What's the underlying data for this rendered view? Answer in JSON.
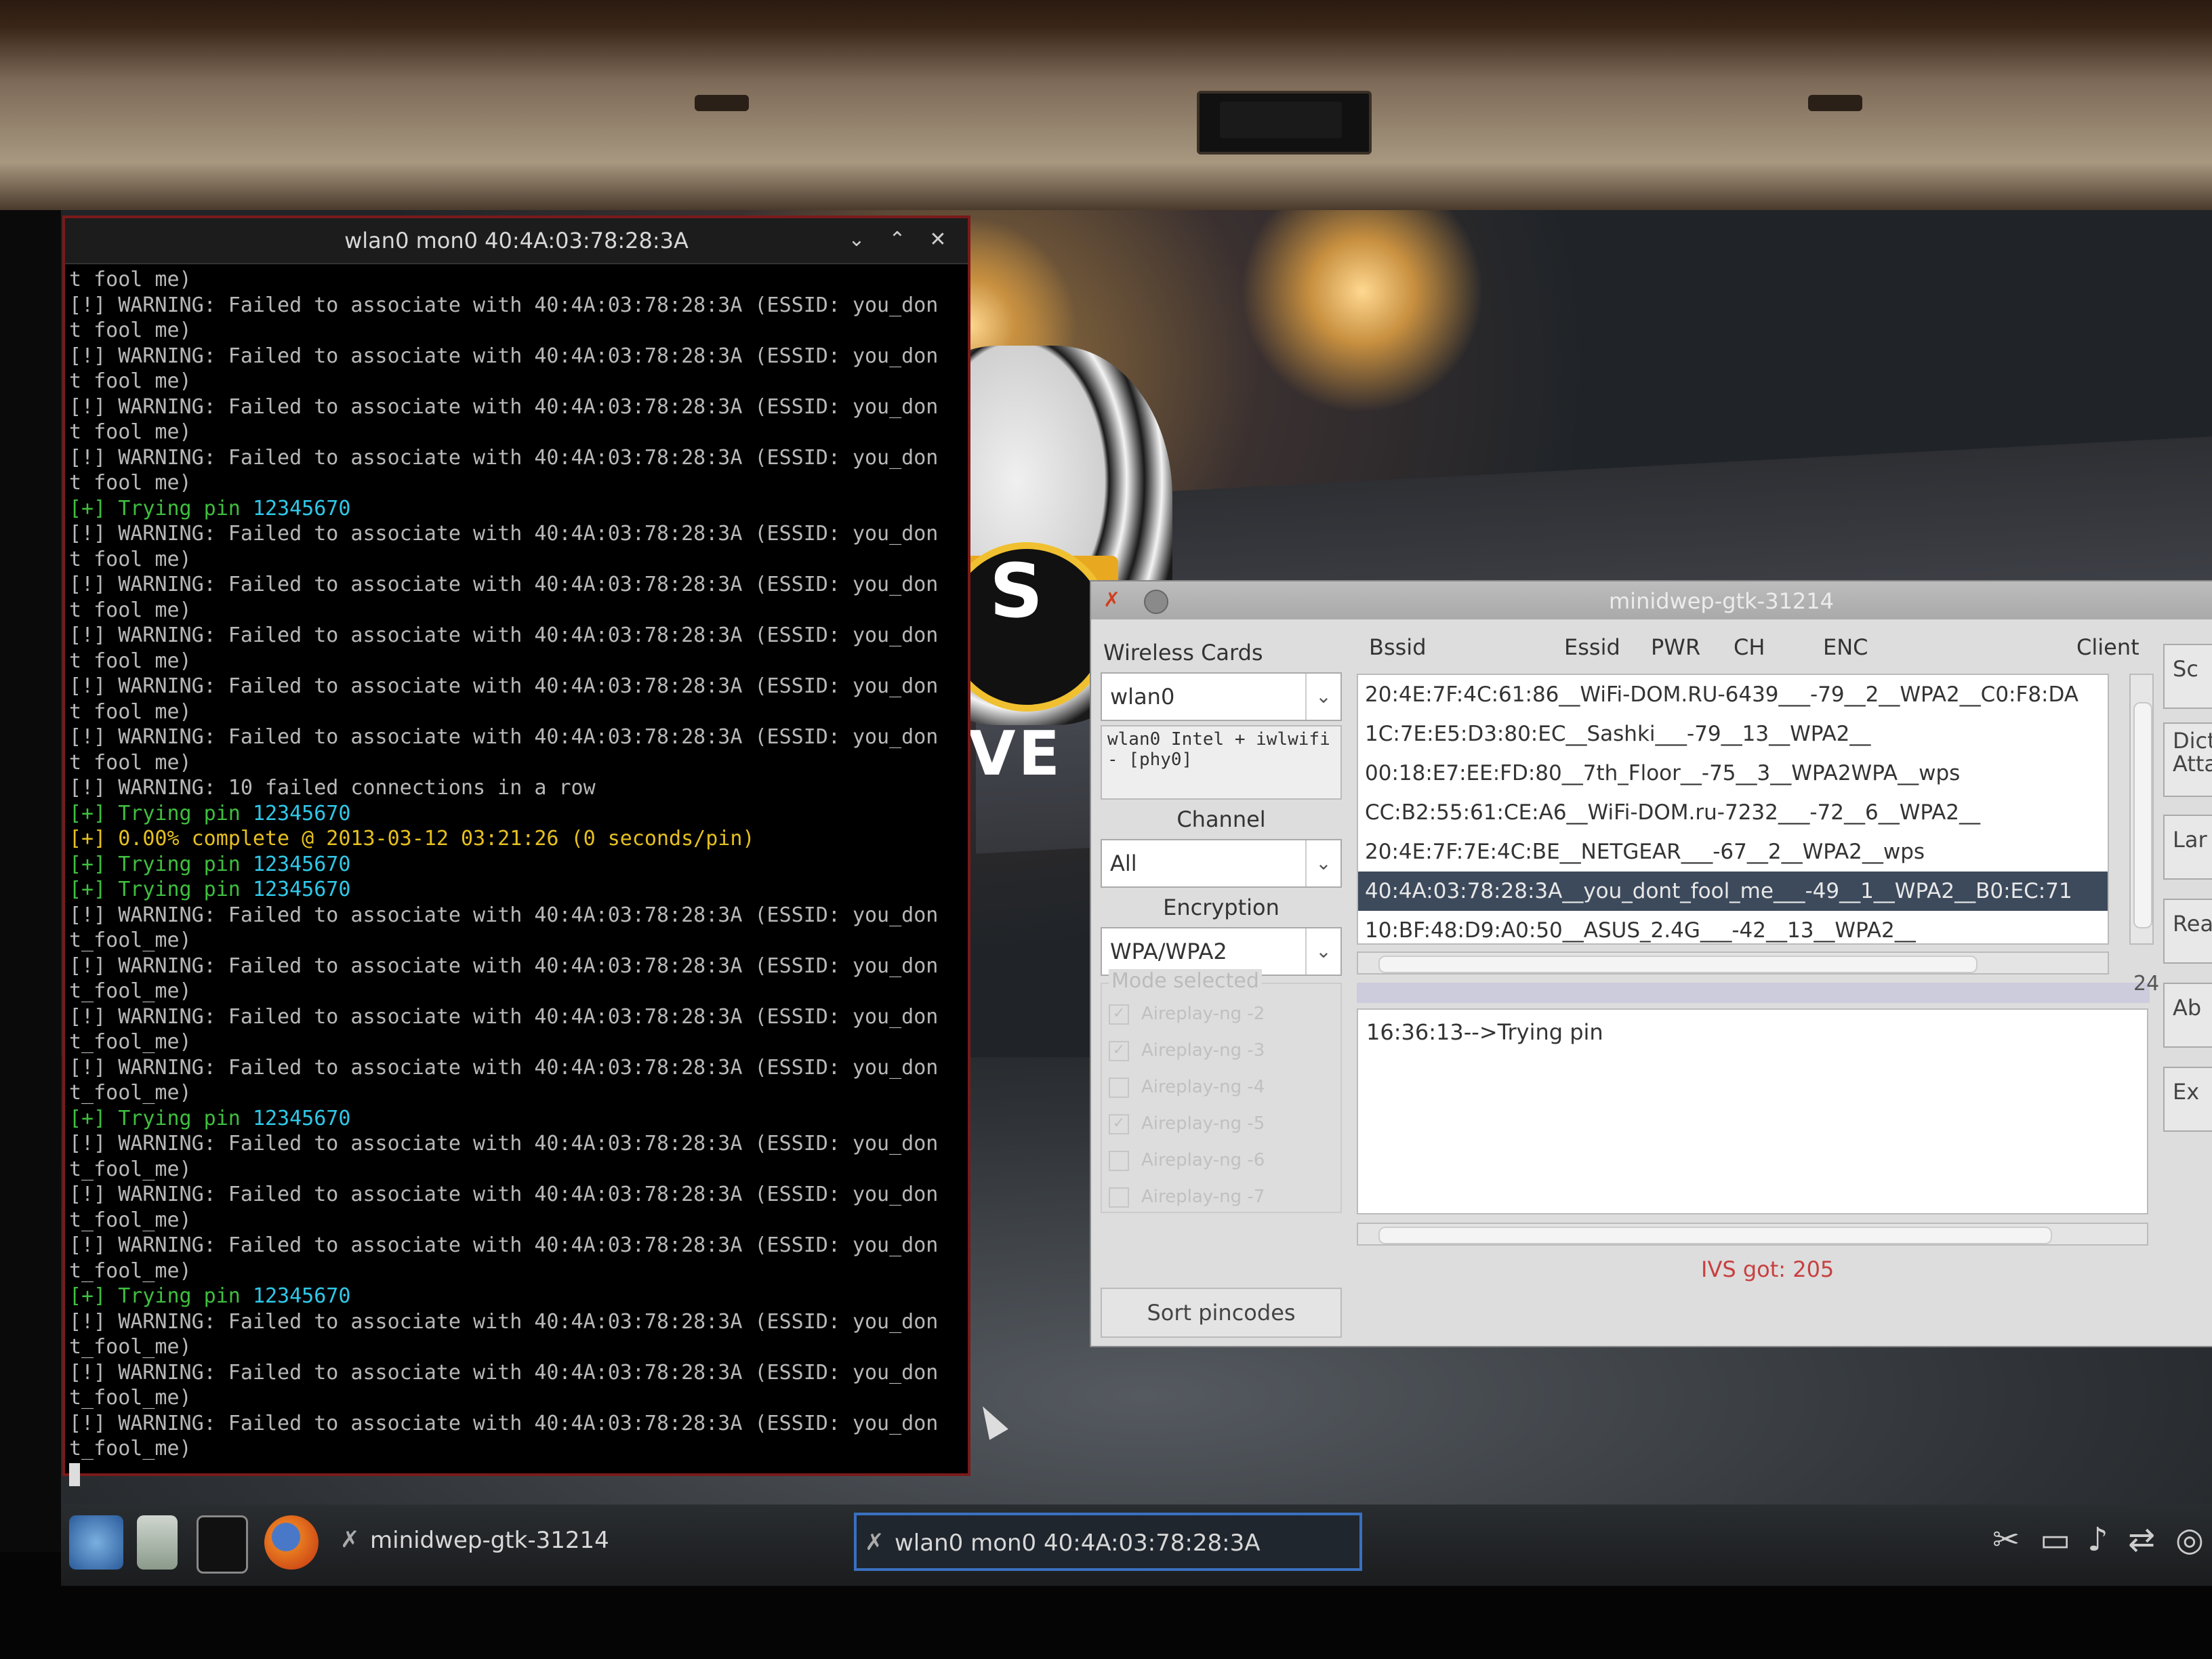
{
  "terminal": {
    "title": "wlan0 mon0 40:4A:03:78:28:3A",
    "lines": [
      {
        "text": "t fool me)",
        "class": ""
      },
      {
        "text": "[!] WARNING: Failed to associate with 40:4A:03:78:28:3A (ESSID: you_don",
        "class": ""
      },
      {
        "text": "t fool me)",
        "class": ""
      },
      {
        "text": "[!] WARNING: Failed to associate with 40:4A:03:78:28:3A (ESSID: you_don",
        "class": ""
      },
      {
        "text": "t fool me)",
        "class": ""
      },
      {
        "text": "[!] WARNING: Failed to associate with 40:4A:03:78:28:3A (ESSID: you_don",
        "class": ""
      },
      {
        "text": "t fool me)",
        "class": ""
      },
      {
        "text": "[!] WARNING: Failed to associate with 40:4A:03:78:28:3A (ESSID: you_don",
        "class": ""
      },
      {
        "text": "t fool me)",
        "class": ""
      },
      {
        "text": "[+] Trying pin ",
        "pin": "12345670",
        "class": "green"
      },
      {
        "text": "[!] WARNING: Failed to associate with 40:4A:03:78:28:3A (ESSID: you_don",
        "class": ""
      },
      {
        "text": "t fool me)",
        "class": ""
      },
      {
        "text": "[!] WARNING: Failed to associate with 40:4A:03:78:28:3A (ESSID: you_don",
        "class": ""
      },
      {
        "text": "t fool me)",
        "class": ""
      },
      {
        "text": "[!] WARNING: Failed to associate with 40:4A:03:78:28:3A (ESSID: you_don",
        "class": ""
      },
      {
        "text": "t fool me)",
        "class": ""
      },
      {
        "text": "[!] WARNING: Failed to associate with 40:4A:03:78:28:3A (ESSID: you_don",
        "class": ""
      },
      {
        "text": "t fool me)",
        "class": ""
      },
      {
        "text": "[!] WARNING: Failed to associate with 40:4A:03:78:28:3A (ESSID: you_don",
        "class": ""
      },
      {
        "text": "t fool me)",
        "class": ""
      },
      {
        "text": "[!] WARNING: 10 failed connections in a row",
        "class": ""
      },
      {
        "text": "[+] Trying pin ",
        "pin": "12345670",
        "class": "green"
      },
      {
        "text": "[+] 0.00% complete @ 2013-03-12 03:21:26 (0 seconds/pin)",
        "class": "yellow"
      },
      {
        "text": "[+] Trying pin ",
        "pin": "12345670",
        "class": "green"
      },
      {
        "text": "[+] Trying pin ",
        "pin": "12345670",
        "class": "green"
      },
      {
        "text": "[!] WARNING: Failed to associate with 40:4A:03:78:28:3A (ESSID: you_don",
        "class": ""
      },
      {
        "text": "t_fool_me)",
        "class": ""
      },
      {
        "text": "[!] WARNING: Failed to associate with 40:4A:03:78:28:3A (ESSID: you_don",
        "class": ""
      },
      {
        "text": "t_fool_me)",
        "class": ""
      },
      {
        "text": "[!] WARNING: Failed to associate with 40:4A:03:78:28:3A (ESSID: you_don",
        "class": ""
      },
      {
        "text": "t_fool_me)",
        "class": ""
      },
      {
        "text": "[!] WARNING: Failed to associate with 40:4A:03:78:28:3A (ESSID: you_don",
        "class": ""
      },
      {
        "text": "t_fool_me)",
        "class": ""
      },
      {
        "text": "[+] Trying pin ",
        "pin": "12345670",
        "class": "green"
      },
      {
        "text": "[!] WARNING: Failed to associate with 40:4A:03:78:28:3A (ESSID: you_don",
        "class": ""
      },
      {
        "text": "t_fool_me)",
        "class": ""
      },
      {
        "text": "[!] WARNING: Failed to associate with 40:4A:03:78:28:3A (ESSID: you_don",
        "class": ""
      },
      {
        "text": "t_fool_me)",
        "class": ""
      },
      {
        "text": "[!] WARNING: Failed to associate with 40:4A:03:78:28:3A (ESSID: you_don",
        "class": ""
      },
      {
        "text": "t_fool_me)",
        "class": ""
      },
      {
        "text": "[+] Trying pin ",
        "pin": "12345670",
        "class": "green"
      },
      {
        "text": "[!] WARNING: Failed to associate with 40:4A:03:78:28:3A (ESSID: you_don",
        "class": ""
      },
      {
        "text": "t_fool_me)",
        "class": ""
      },
      {
        "text": "[!] WARNING: Failed to associate with 40:4A:03:78:28:3A (ESSID: you_don",
        "class": ""
      },
      {
        "text": "t_fool_me)",
        "class": ""
      },
      {
        "text": "[!] WARNING: Failed to associate with 40:4A:03:78:28:3A (ESSID: you_don",
        "class": ""
      },
      {
        "text": "t_fool_me)",
        "class": ""
      }
    ]
  },
  "wallpaper": {
    "logo_letter": "S",
    "logo_text": "LIVE"
  },
  "minidwep": {
    "title": "minidwep-gtk-31214",
    "wireless_cards_label": "Wireless Cards",
    "card_selected": "wlan0",
    "card_info": "wlan0 Intel + iwlwifi - [phy0]",
    "channel_label": "Channel",
    "channel_selected": "All",
    "encryption_label": "Encryption",
    "encryption_selected": "WPA/WPA2",
    "mode_label": "Mode selected",
    "modes": [
      {
        "label": "Aireplay-ng -2",
        "checked": true
      },
      {
        "label": "Aireplay-ng -3",
        "checked": true
      },
      {
        "label": "Aireplay-ng -4",
        "checked": false
      },
      {
        "label": "Aireplay-ng -5",
        "checked": true
      },
      {
        "label": "Aireplay-ng -6",
        "checked": false
      },
      {
        "label": "Aireplay-ng -7",
        "checked": false
      }
    ],
    "sort_button": "Sort pincodes",
    "columns": [
      "Bssid",
      "Essid",
      "PWR",
      "CH",
      "ENC",
      "Client"
    ],
    "networks": [
      "20:4E:7F:4C:61:86__WiFi-DOM.RU-6439___-79__2__WPA2__C0:F8:DA",
      "1C:7E:E5:D3:80:EC__Sashki___-79__13__WPA2__",
      "00:18:E7:EE:FD:80__7th_Floor__-75__3__WPA2WPA__wps",
      "CC:B2:55:61:CE:A6__WiFi-DOM.ru-7232___-72__6__WPA2__",
      "20:4E:7F:7E:4C:BE__NETGEAR___-67__2__WPA2__wps",
      "40:4A:03:78:28:3A__you_dont_fool_me___-49__1__WPA2__B0:EC:71",
      "10:BF:48:D9:A0:50__ASUS_2.4G___-42__13__WPA2__"
    ],
    "selected_network_index": 5,
    "count_label": "24",
    "log_text": "16:36:13-->Trying pin",
    "ivs_text": "IVS got: 205",
    "right_buttons": [
      "Sc",
      "Dicti\nAtta",
      "Lar",
      "Rea",
      "Ab",
      "Ex"
    ]
  },
  "taskbar": {
    "tasks": [
      {
        "label": "minidwep-gtk-31214",
        "active": false
      },
      {
        "label": "wlan0 mon0 40:4A:03:78:28:3A",
        "active": true
      }
    ],
    "launchers": [
      "kde-menu-icon",
      "file-manager-icon",
      "terminal-icon",
      "firefox-icon"
    ],
    "tray": [
      "scissors-icon",
      "display-icon",
      "volume-icon",
      "network-icon",
      "more-icon"
    ]
  }
}
